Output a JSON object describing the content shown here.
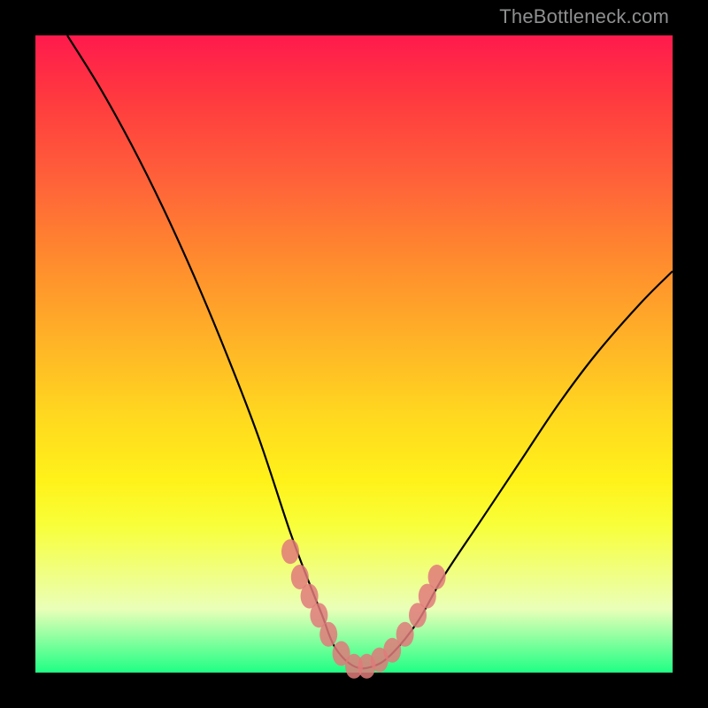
{
  "watermark": "TheBottleneck.com",
  "chart_data": {
    "type": "line",
    "title": "",
    "xlabel": "",
    "ylabel": "",
    "xlim": [
      0,
      100
    ],
    "ylim": [
      0,
      100
    ],
    "series": [
      {
        "name": "curve",
        "x": [
          5,
          10,
          15,
          20,
          25,
          30,
          35,
          40,
          43,
          45,
          47,
          50,
          53,
          56,
          60,
          64,
          70,
          76,
          82,
          88,
          95,
          100
        ],
        "y": [
          100,
          92,
          83,
          73,
          62,
          50,
          37,
          22,
          14,
          9,
          4,
          1,
          1,
          3,
          8,
          15,
          24,
          33,
          42,
          50,
          58,
          63
        ]
      }
    ],
    "markers": {
      "name": "highlight-points",
      "color": "#e07a7a",
      "x": [
        40,
        41.5,
        43,
        44.5,
        46,
        48,
        50,
        52,
        54,
        56,
        58,
        60,
        61.5,
        63
      ],
      "y": [
        19,
        15,
        12,
        9,
        6,
        3,
        1,
        1,
        2,
        3.5,
        6,
        9,
        12,
        15
      ]
    },
    "background": "rainbow-vertical-gradient"
  }
}
